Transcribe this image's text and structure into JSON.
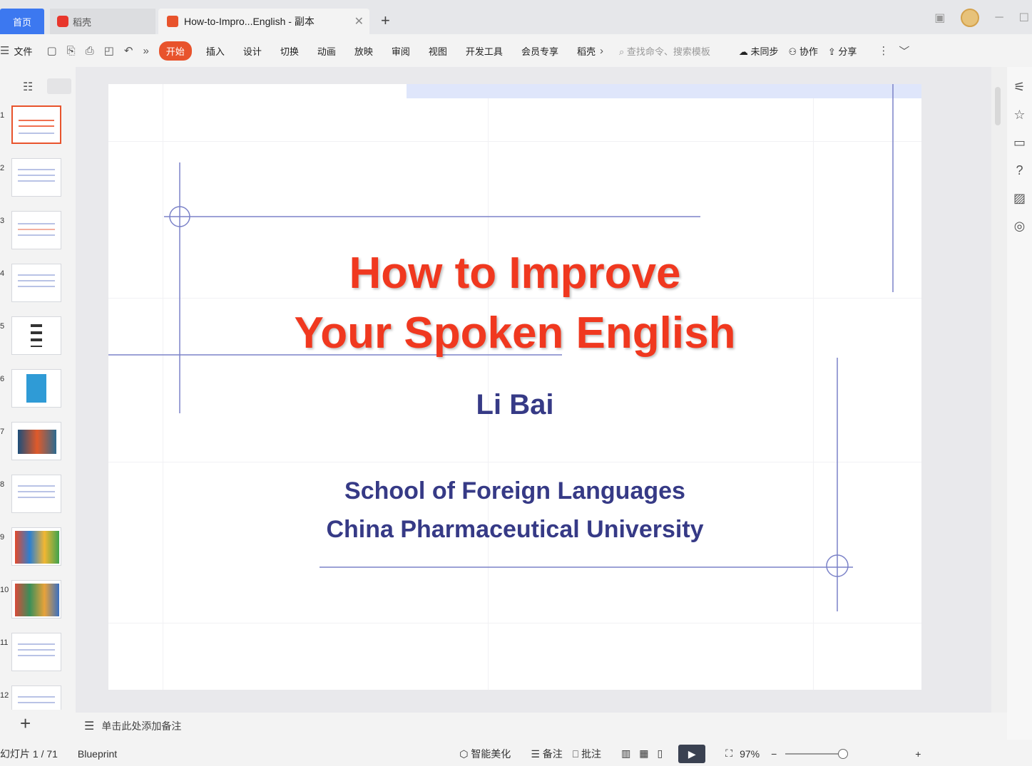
{
  "tabs": {
    "home": "首页",
    "daoke": "稻壳",
    "doc": "How-to-Impro...English - 副本"
  },
  "ribbon": {
    "file": "文件",
    "items": [
      "开始",
      "插入",
      "设计",
      "切换",
      "动画",
      "放映",
      "审阅",
      "视图",
      "开发工具",
      "会员专享",
      "稻壳"
    ],
    "search_placeholder": "查找命令、搜索模板",
    "sync": "未同步",
    "collab": "协作",
    "share": "分享"
  },
  "thumbnails": [
    "1",
    "2",
    "3",
    "4",
    "5",
    "6",
    "7",
    "8",
    "9",
    "10",
    "11",
    "12"
  ],
  "slide": {
    "title_line1": "How to Improve",
    "title_line2": "Your Spoken English",
    "author": "Li Bai",
    "school_line1": "School of Foreign Languages",
    "school_line2": "China Pharmaceutical University"
  },
  "notes": {
    "placeholder": "单击此处添加备注"
  },
  "status": {
    "slide_counter": "幻灯片 1 / 71",
    "theme": "Blueprint",
    "beautify": "智能美化",
    "notes_btn": "备注",
    "comment_btn": "批注",
    "zoom": "97%"
  },
  "colors": {
    "accent": "#e8532c",
    "title_red": "#f0381f",
    "navy": "#363a86",
    "home_tab": "#3c78f0"
  }
}
